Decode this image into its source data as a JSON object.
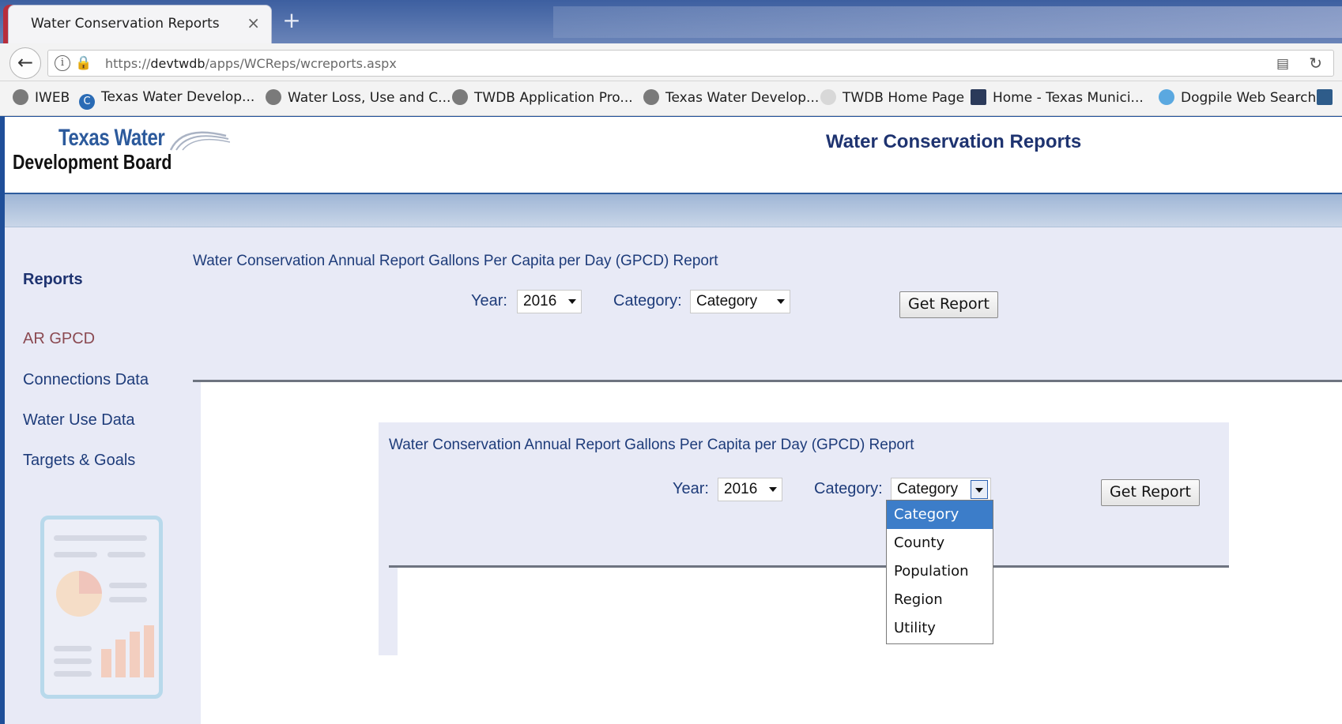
{
  "browser": {
    "tab_title": "Water Conservation Reports",
    "tab_close": "×",
    "new_tab": "+",
    "url_prefix": "https://",
    "url_domain": "devtwdb",
    "url_path": "/apps/WCReps/wcreports.aspx",
    "bookmarks": [
      "IWEB",
      "Texas Water Develop...",
      "Water Loss, Use and C...",
      "TWDB Application Pro...",
      "Texas Water Develop...",
      "TWDB Home Page",
      "Home - Texas Munici...",
      "Dogpile Web Search"
    ]
  },
  "header": {
    "logo_line1": "Texas Water",
    "logo_line2": "Development Board",
    "site_title": "Water Conservation Reports"
  },
  "sidebar": {
    "title": "Reports",
    "links": [
      "AR GPCD",
      "Connections Data",
      "Water Use Data",
      "Targets & Goals"
    ]
  },
  "main": {
    "heading": "Water Conservation Annual Report Gallons Per Capita per Day (GPCD) Report",
    "year_label": "Year:",
    "year_value": "2016",
    "category_label": "Category:",
    "category_value": "Category",
    "button_label": "Get Report"
  },
  "inner": {
    "heading": "Water Conservation Annual Report Gallons Per Capita per Day (GPCD) Report",
    "year_label": "Year:",
    "year_value": "2016",
    "category_label": "Category:",
    "category_value": "Category",
    "button_label": "Get Report",
    "options": [
      "Category",
      "County",
      "Population",
      "Region",
      "Utility"
    ]
  },
  "colors": {
    "brand_navy": "#1e3370",
    "link_blue": "#1e3c7a",
    "page_bg": "#e8eaf6",
    "selected_option": "#3c7dc9"
  }
}
